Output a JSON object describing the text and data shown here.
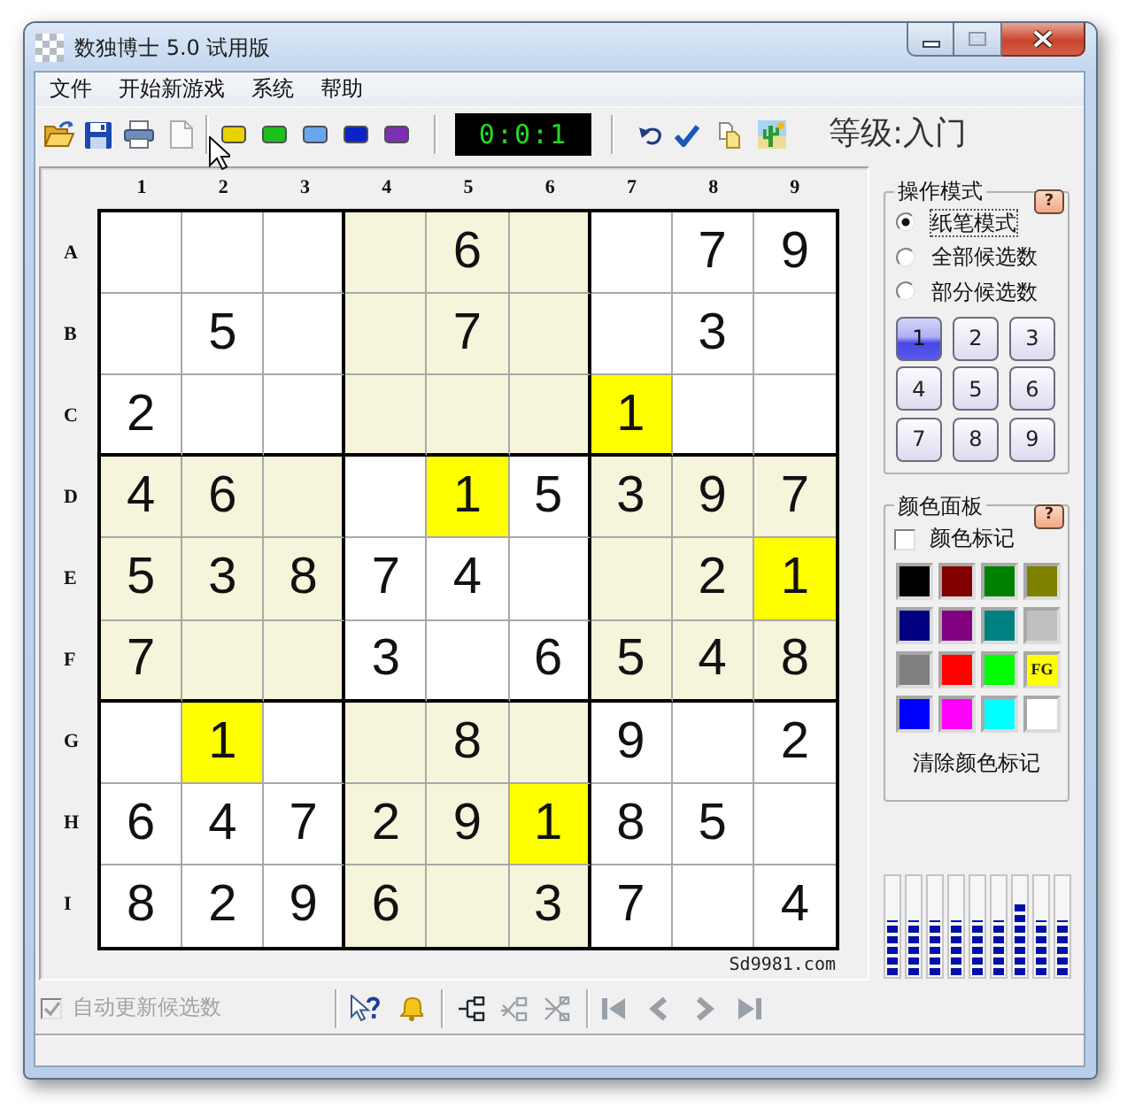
{
  "window": {
    "title": "数独博士 5.0 试用版"
  },
  "menu": [
    "文件",
    "开始新游戏",
    "系统",
    "帮助"
  ],
  "toolbar": {
    "color_chips": [
      {
        "color": "#e8d200"
      },
      {
        "color": "#1cc01c"
      },
      {
        "color": "#6aa6ee"
      },
      {
        "color": "#0a22c8"
      },
      {
        "color": "#7a30b0"
      }
    ],
    "timer": "0:0:1",
    "difficulty": "等级:入门"
  },
  "board": {
    "columns": [
      "1",
      "2",
      "3",
      "4",
      "5",
      "6",
      "7",
      "8",
      "9"
    ],
    "rows": [
      {
        "label": "A",
        "cells": [
          {
            "highlighted": false
          },
          {
            "highlighted": false
          },
          {
            "highlighted": false
          },
          {
            "highlighted": false
          },
          {
            "value": "6",
            "highlighted": false
          },
          {
            "highlighted": false
          },
          {
            "highlighted": false
          },
          {
            "value": "7",
            "highlighted": false
          },
          {
            "value": "9",
            "highlighted": false
          }
        ]
      },
      {
        "label": "B",
        "cells": [
          {
            "highlighted": false
          },
          {
            "value": "5",
            "highlighted": false
          },
          {
            "highlighted": false
          },
          {
            "highlighted": false
          },
          {
            "value": "7",
            "highlighted": false
          },
          {
            "highlighted": false
          },
          {
            "highlighted": false
          },
          {
            "value": "3",
            "highlighted": false
          },
          {
            "highlighted": false
          }
        ]
      },
      {
        "label": "C",
        "cells": [
          {
            "value": "2",
            "highlighted": false
          },
          {
            "highlighted": false
          },
          {
            "highlighted": false
          },
          {
            "highlighted": false
          },
          {
            "highlighted": false
          },
          {
            "highlighted": false
          },
          {
            "value": "1",
            "highlighted": true
          },
          {
            "highlighted": false
          },
          {
            "highlighted": false
          }
        ]
      },
      {
        "label": "D",
        "cells": [
          {
            "value": "4",
            "highlighted": false
          },
          {
            "value": "6",
            "highlighted": false
          },
          {
            "highlighted": false
          },
          {
            "highlighted": false
          },
          {
            "value": "1",
            "highlighted": true
          },
          {
            "value": "5",
            "highlighted": false
          },
          {
            "value": "3",
            "highlighted": false
          },
          {
            "value": "9",
            "highlighted": false
          },
          {
            "value": "7",
            "highlighted": false
          }
        ]
      },
      {
        "label": "E",
        "cells": [
          {
            "value": "5",
            "highlighted": false
          },
          {
            "value": "3",
            "highlighted": false
          },
          {
            "value": "8",
            "highlighted": false
          },
          {
            "value": "7",
            "highlighted": false
          },
          {
            "value": "4",
            "highlighted": false
          },
          {
            "highlighted": false
          },
          {
            "highlighted": false
          },
          {
            "value": "2",
            "highlighted": false
          },
          {
            "value": "1",
            "highlighted": true
          }
        ]
      },
      {
        "label": "F",
        "cells": [
          {
            "value": "7",
            "highlighted": false
          },
          {
            "highlighted": false
          },
          {
            "highlighted": false
          },
          {
            "value": "3",
            "highlighted": false
          },
          {
            "highlighted": false
          },
          {
            "value": "6",
            "highlighted": false
          },
          {
            "value": "5",
            "highlighted": false
          },
          {
            "value": "4",
            "highlighted": false
          },
          {
            "value": "8",
            "highlighted": false
          }
        ]
      },
      {
        "label": "G",
        "cells": [
          {
            "highlighted": false
          },
          {
            "value": "1",
            "highlighted": true
          },
          {
            "highlighted": false
          },
          {
            "highlighted": false
          },
          {
            "value": "8",
            "highlighted": false
          },
          {
            "highlighted": false
          },
          {
            "value": "9",
            "highlighted": false
          },
          {
            "highlighted": false
          },
          {
            "value": "2",
            "highlighted": false
          }
        ]
      },
      {
        "label": "H",
        "cells": [
          {
            "value": "6",
            "highlighted": false
          },
          {
            "value": "4",
            "highlighted": false
          },
          {
            "value": "7",
            "highlighted": false
          },
          {
            "value": "2",
            "highlighted": false
          },
          {
            "value": "9",
            "highlighted": false
          },
          {
            "value": "1",
            "highlighted": true
          },
          {
            "value": "8",
            "highlighted": false
          },
          {
            "value": "5",
            "highlighted": false
          },
          {
            "highlighted": false
          }
        ]
      },
      {
        "label": "I",
        "cells": [
          {
            "value": "8",
            "highlighted": false
          },
          {
            "value": "2",
            "highlighted": false
          },
          {
            "value": "9",
            "highlighted": false
          },
          {
            "value": "6",
            "highlighted": false
          },
          {
            "highlighted": false
          },
          {
            "value": "3",
            "highlighted": false
          },
          {
            "value": "7",
            "highlighted": false
          },
          {
            "highlighted": false
          },
          {
            "value": "4",
            "highlighted": false
          }
        ]
      }
    ],
    "credit": "Sd9981.com"
  },
  "mode_panel": {
    "title": "操作模式",
    "help": "?",
    "modes": [
      {
        "label": "纸笔模式",
        "selected": true
      },
      {
        "label": "全部候选数",
        "selected": false
      },
      {
        "label": "部分候选数",
        "selected": false
      }
    ],
    "numbers": [
      {
        "label": "1",
        "selected": true
      },
      {
        "label": "2",
        "selected": false
      },
      {
        "label": "3",
        "selected": false
      },
      {
        "label": "4",
        "selected": false
      },
      {
        "label": "5",
        "selected": false
      },
      {
        "label": "6",
        "selected": false
      },
      {
        "label": "7",
        "selected": false
      },
      {
        "label": "8",
        "selected": false
      },
      {
        "label": "9",
        "selected": false
      }
    ]
  },
  "color_panel": {
    "title": "颜色面板",
    "help": "?",
    "color_mark": {
      "label": "颜色标记",
      "checked": false
    },
    "swatches": [
      {
        "color": "#000000"
      },
      {
        "color": "#800000"
      },
      {
        "color": "#008000"
      },
      {
        "color": "#808000"
      },
      {
        "color": "#000080"
      },
      {
        "color": "#800080"
      },
      {
        "color": "#008080"
      },
      {
        "color": "#c0c0c0"
      },
      {
        "color": "#808080"
      },
      {
        "color": "#ff0000"
      },
      {
        "color": "#00ff00"
      },
      {
        "color": "#ffff00",
        "label": "FG"
      },
      {
        "color": "#0000ff"
      },
      {
        "color": "#ff00ff"
      },
      {
        "color": "#00ffff"
      },
      {
        "color": "#ffffff"
      }
    ],
    "clear_button": "清除颜色标记"
  },
  "meters": [
    {
      "level": 0.55
    },
    {
      "level": 0.55
    },
    {
      "level": 0.55
    },
    {
      "level": 0.55
    },
    {
      "level": 0.55
    },
    {
      "level": 0.55
    },
    {
      "level": 0.75
    },
    {
      "level": 0.55
    },
    {
      "level": 0.55
    }
  ],
  "bottom_toolbar": {
    "auto_update": {
      "label": "自动更新候选数",
      "checked": true,
      "disabled": true
    },
    "tree_tools": [
      {
        "disabled": false
      },
      {
        "disabled": true
      },
      {
        "disabled": true
      }
    ],
    "navigation": [
      {
        "disabled": true
      },
      {
        "disabled": true
      },
      {
        "disabled": true
      },
      {
        "disabled": true
      }
    ]
  }
}
